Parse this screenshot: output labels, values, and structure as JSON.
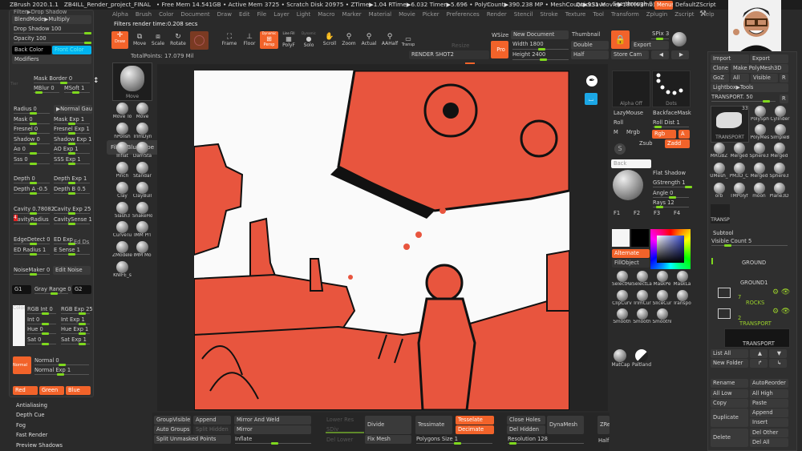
{
  "titlebar": {
    "app": "ZBrush 2020.1.1",
    "project": "ZB4ILL_Render_project_FINAL",
    "stats": "• Free Mem 14.541GB • Active Mem 3725 • Scratch Disk 20975 • ZTime▶1.04 RTime▶6.032 Timer▶5.696 • PolyCount▶390.238 MP • MeshCount▶931 Movie▶180(63mb)",
    "ac": "AC",
    "quicksave": "QuickSave",
    "see_through": "See-through 0",
    "menus": "Menus",
    "script": "DefaultZScript"
  },
  "menu": [
    "Alpha",
    "Brush",
    "Color",
    "Document",
    "Draw",
    "Edit",
    "File",
    "Layer",
    "Light",
    "Macro",
    "Marker",
    "Material",
    "Movie",
    "Picker",
    "Preferences",
    "Render",
    "Stencil",
    "Stroke",
    "Texture",
    "Tool",
    "Transform",
    "Zplugin",
    "Zscript",
    "Help"
  ],
  "status": {
    "filters": "Filters render time:0.208 secs",
    "total_points": "TotalPoints: 17.079 Mil"
  },
  "shelf": {
    "draw": "Draw",
    "move": "Move",
    "scale": "Scale",
    "rotate": "Rotate",
    "frame": "Frame",
    "floor": "Floor",
    "persp": "Persp",
    "persp_tag": "Dynamic",
    "polyf": "PolyF",
    "polyf_tag": "Line Fill",
    "solo": "Solo",
    "solo_tag": "Dynamic",
    "scroll": "Scroll",
    "zoom": "Zoom",
    "actual": "Actual",
    "aahalf": "AAHalf",
    "transp": "Transp",
    "resize": "Resize",
    "render_shot": "RENDER SHOT2",
    "wsize": "WSize",
    "pro": "Pro",
    "new_document": "New Document",
    "width": "Width 1800",
    "height": "Height 2400",
    "thumbnail": "Thumbnail",
    "double": "Double",
    "half": "Half",
    "export": "Export",
    "store_cam": "Store Cam",
    "spix": "SPix 3",
    "bpr": "BPR"
  },
  "left": {
    "filter": "Filter▶Drop Shadow",
    "blendmode": "BlendMode▶Multiply",
    "drop_shadow": "Drop Shadow 100",
    "opacity": "Opacity 100",
    "back_color": "Back Color",
    "front_color": "Front Color",
    "modifiers": "Modifiers",
    "tier": "Tier",
    "mask_border": "Mask Border 0",
    "mblur": "MBlur 0",
    "msoft": "MSoft 1",
    "rows": [
      [
        "Radius 0",
        "▶Normal Gauss"
      ],
      [
        "Mask 0",
        "Mask Exp 1"
      ],
      [
        "Fresnel 0",
        "Fresnel Exp 1"
      ],
      [
        "Shadow 0",
        "Shadow Exp 1"
      ],
      [
        "Ao 0",
        "AO Exp 1"
      ],
      [
        "Sss 0",
        "SSS Exp 1"
      ]
    ],
    "rows2": [
      [
        "Depth 0",
        "Depth Exp 1"
      ],
      [
        "Depth A -0.5",
        "Depth B 0.5"
      ]
    ],
    "rows3": [
      [
        "Cavity 0.78082",
        "Cavity Exp 25"
      ],
      [
        "CavityRadius",
        "CavitySense 1"
      ]
    ],
    "cavity_badge": "4",
    "rows4": [
      [
        "EdgeDetect 0",
        "ED Exp"
      ],
      [
        "ED Radius 1",
        "E Sense 1"
      ]
    ],
    "ed_ds": "Ed Ds",
    "noisemaker": "NoiseMaker 0",
    "edit_noise": "Edit Noise",
    "g1": "G1",
    "gray_range": "Gray Range 0",
    "g2": "G2",
    "color_label": "Color",
    "rows5": [
      [
        "RGB Int 0",
        "RGB Exp 25"
      ],
      [
        "Int 0",
        "Int Exp 1"
      ],
      [
        "Hue 0",
        "Hue Exp 1"
      ],
      [
        "Sat 0",
        "Sat Exp 1"
      ]
    ],
    "normal_label": "Normal",
    "normal": "Normal 0",
    "normal_exp": "Normal Exp 1",
    "red": "Red",
    "green": "Green",
    "blue": "Blue"
  },
  "render_list": [
    "Antialiasing",
    "Depth Cue",
    "Fog",
    "Fast Render",
    "Preview Shadows"
  ],
  "brushes": [
    "Move",
    "Move To",
    "Move",
    "hPolish",
    "TrimDyn",
    "Inflat",
    "DamSta",
    "Pinch",
    "Standar",
    "Clay",
    "ClayBuil",
    "Slash3",
    "SnakeHo",
    "CurveTu",
    "IMM Pri",
    "ZModele",
    "IMM Mo",
    "KNIFE_s"
  ],
  "tooltip": "Filter Blur Type",
  "rightshelf": {
    "alpha": "Alpha Off",
    "stroke": "Dots",
    "lazymouse": "LazyMouse",
    "backface": "BackfaceMask",
    "roll": "Roll",
    "roll_dist": "Roll Dist 1",
    "m": "M",
    "mrgb": "Mrgb",
    "rgb": "Rgb",
    "a": "A",
    "zsub": "Zsub",
    "zadd": "Zadd",
    "back": "Back",
    "flat_shadow": "Flat Shadow",
    "gstrength": "GStrength 1",
    "angle": "Angle 0",
    "rays": "Rays 12",
    "f1": "F1",
    "f2": "F2",
    "f3": "F3",
    "f4": "F4",
    "alternate": "Alternate",
    "fillobject": "FillObject",
    "tools": [
      "SelectRe",
      "SelectLa",
      "MaskPe",
      "MaskLa",
      "ClipCurv",
      "TrimCur",
      "SliceCur",
      "Transpo",
      "Smooth",
      "Smooth",
      "Smoothl"
    ],
    "matcap": "MatCap",
    "flatland": "Paltland"
  },
  "tool": {
    "import": "Import",
    "export": "Export",
    "clone": "Clone",
    "make_polymesh": "Make PolyMesh3D",
    "goz": "GoZ",
    "all": "All",
    "visible": "Visible",
    "r": "R",
    "lightbox": "Lightbox▶Tools",
    "current": "TRANSPORT. 50",
    "thumb_count": "33",
    "thumb_label": "TRANSPORT",
    "items": [
      "PolySph",
      "Cylinder",
      "PolyMes",
      "SimpleB",
      "MRGBZ",
      "Merged",
      "Sphere3",
      "Merged",
      "UMesh_",
      "PM3D_C",
      "Merged",
      "Sphere3",
      "orb",
      "TMPolyf",
      "moon",
      "Plane3D"
    ],
    "transp": "TRANSP"
  },
  "subtool": {
    "title": "Subtool",
    "visible_count": "Visible Count 5",
    "items": [
      "GROUND",
      "GROUND1"
    ],
    "folder1_count": "7",
    "folder1": "ROCKS",
    "folder2_count": "2",
    "folder2": "TRANSPORT",
    "selected": "TRANSPORT",
    "list_all": "List All",
    "new_folder": "New Folder",
    "rename": "Rename",
    "autoreorder": "AutoReorder",
    "all_low": "All Low",
    "all_high": "All High",
    "copy": "Copy",
    "paste": "Paste",
    "duplicate": "Duplicate",
    "append": "Append",
    "insert": "Insert",
    "delete": "Delete",
    "del_other": "Del Other",
    "del_all": "Del All"
  },
  "bottom": {
    "groupvisible": "GroupVisible",
    "append": "Append",
    "mirror_weld": "Mirror And Weld",
    "auto_groups": "Auto Groups",
    "split_hidden": "Split Hidden",
    "mirror": "Mirror",
    "split_unmasked": "Split Unmasked Points",
    "inflate": "Inflate",
    "lower_res": "Lower Res",
    "sdiv": "SDiv",
    "del_lower": "Del Lower",
    "divide": "Divide",
    "fix_mesh": "Fix Mesh",
    "tessimate": "Tessimate",
    "tesselate": "Tesselate",
    "decimate": "Decimate",
    "polygons_size": "Polygons Size 1",
    "close_holes": "Close Holes",
    "del_hidden": "Del Hidden",
    "dynamesh": "DynaMesh",
    "resolution": "Resolution 128",
    "zremesher": "ZRer",
    "half": "Half"
  },
  "colors": {
    "accent": "#f2632a",
    "slider": "#7fd81e",
    "front_color": "#00b4f0",
    "art_red": "#e8553e"
  }
}
